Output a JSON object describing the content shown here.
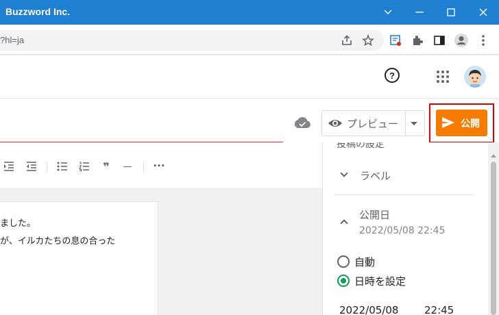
{
  "window": {
    "title": "Buzzword Inc.",
    "controls": {
      "collapse": "⌄",
      "minimize": "—",
      "maximize": "☐",
      "close": "✕"
    }
  },
  "browser": {
    "url_fragment": "?hl=ja",
    "icons": [
      "share-icon",
      "star-icon",
      "extension-badge-icon",
      "puzzle-icon",
      "side-panel-icon",
      "profile-icon",
      "kebab-menu-icon"
    ]
  },
  "app_header": {
    "help_glyph": "?",
    "icons": [
      "help-icon",
      "apps-grid-icon",
      "account-avatar"
    ]
  },
  "editor_header": {
    "preview_label": "プレビュー",
    "publish_label": "公開",
    "publish_color": "#f57c00",
    "highlight_color": "#e00000"
  },
  "toolbar": {
    "icons": [
      "indent-icon",
      "outdent-icon",
      "bulleted-list-icon",
      "numbered-list-icon",
      "quote-icon",
      "horizontal-rule-icon",
      "more-icon"
    ],
    "quote_glyph": "❞",
    "rule_glyph": "—",
    "more_glyph": "•••"
  },
  "content": {
    "lines": [
      "ました。",
      "が、イルカたちの息の合った"
    ]
  },
  "settings_panel": {
    "cut_heading": "投稿の設定",
    "label_section": "ラベル",
    "publish_date_section": "公開日",
    "publish_date_value": "2022/05/08 22:45",
    "options": [
      {
        "label": "自動",
        "selected": false
      },
      {
        "label": "日時を設定",
        "selected": true
      }
    ],
    "date_field": "2022/05/08",
    "time_field": "22:45"
  }
}
